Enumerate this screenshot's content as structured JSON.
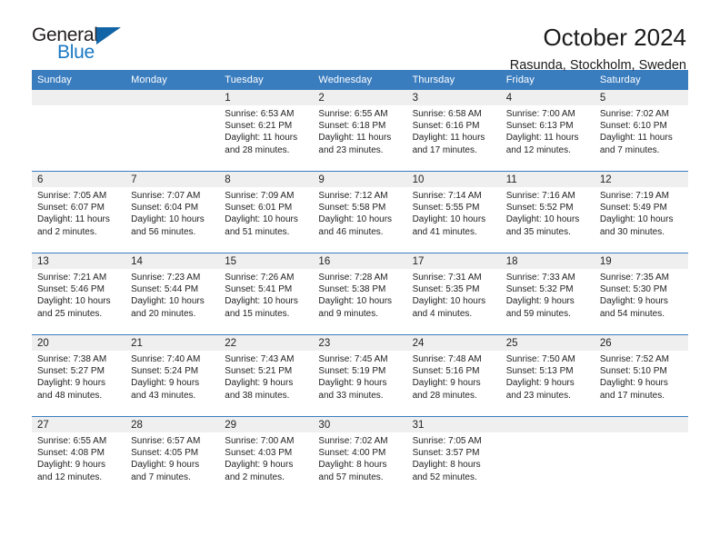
{
  "brand": {
    "name_part1": "General",
    "name_part2": "Blue",
    "triangle_color": "#1164a5",
    "blue_color": "#1878c4"
  },
  "header": {
    "title": "October 2024",
    "subtitle": "Rasunda, Stockholm, Sweden"
  },
  "theme": {
    "header_bg": "#3a7dbf",
    "daynum_bg": "#efefef",
    "row_divider": "#3a7dbf",
    "text": "#222222"
  },
  "calendar": {
    "weekday_headers": [
      "Sunday",
      "Monday",
      "Tuesday",
      "Wednesday",
      "Thursday",
      "Friday",
      "Saturday"
    ],
    "weeks": [
      [
        {
          "day": "",
          "sunrise": "",
          "sunset": "",
          "daylight_line1": "",
          "daylight_line2": ""
        },
        {
          "day": "",
          "sunrise": "",
          "sunset": "",
          "daylight_line1": "",
          "daylight_line2": ""
        },
        {
          "day": "1",
          "sunrise": "Sunrise: 6:53 AM",
          "sunset": "Sunset: 6:21 PM",
          "daylight_line1": "Daylight: 11 hours",
          "daylight_line2": "and 28 minutes."
        },
        {
          "day": "2",
          "sunrise": "Sunrise: 6:55 AM",
          "sunset": "Sunset: 6:18 PM",
          "daylight_line1": "Daylight: 11 hours",
          "daylight_line2": "and 23 minutes."
        },
        {
          "day": "3",
          "sunrise": "Sunrise: 6:58 AM",
          "sunset": "Sunset: 6:16 PM",
          "daylight_line1": "Daylight: 11 hours",
          "daylight_line2": "and 17 minutes."
        },
        {
          "day": "4",
          "sunrise": "Sunrise: 7:00 AM",
          "sunset": "Sunset: 6:13 PM",
          "daylight_line1": "Daylight: 11 hours",
          "daylight_line2": "and 12 minutes."
        },
        {
          "day": "5",
          "sunrise": "Sunrise: 7:02 AM",
          "sunset": "Sunset: 6:10 PM",
          "daylight_line1": "Daylight: 11 hours",
          "daylight_line2": "and 7 minutes."
        }
      ],
      [
        {
          "day": "6",
          "sunrise": "Sunrise: 7:05 AM",
          "sunset": "Sunset: 6:07 PM",
          "daylight_line1": "Daylight: 11 hours",
          "daylight_line2": "and 2 minutes."
        },
        {
          "day": "7",
          "sunrise": "Sunrise: 7:07 AM",
          "sunset": "Sunset: 6:04 PM",
          "daylight_line1": "Daylight: 10 hours",
          "daylight_line2": "and 56 minutes."
        },
        {
          "day": "8",
          "sunrise": "Sunrise: 7:09 AM",
          "sunset": "Sunset: 6:01 PM",
          "daylight_line1": "Daylight: 10 hours",
          "daylight_line2": "and 51 minutes."
        },
        {
          "day": "9",
          "sunrise": "Sunrise: 7:12 AM",
          "sunset": "Sunset: 5:58 PM",
          "daylight_line1": "Daylight: 10 hours",
          "daylight_line2": "and 46 minutes."
        },
        {
          "day": "10",
          "sunrise": "Sunrise: 7:14 AM",
          "sunset": "Sunset: 5:55 PM",
          "daylight_line1": "Daylight: 10 hours",
          "daylight_line2": "and 41 minutes."
        },
        {
          "day": "11",
          "sunrise": "Sunrise: 7:16 AM",
          "sunset": "Sunset: 5:52 PM",
          "daylight_line1": "Daylight: 10 hours",
          "daylight_line2": "and 35 minutes."
        },
        {
          "day": "12",
          "sunrise": "Sunrise: 7:19 AM",
          "sunset": "Sunset: 5:49 PM",
          "daylight_line1": "Daylight: 10 hours",
          "daylight_line2": "and 30 minutes."
        }
      ],
      [
        {
          "day": "13",
          "sunrise": "Sunrise: 7:21 AM",
          "sunset": "Sunset: 5:46 PM",
          "daylight_line1": "Daylight: 10 hours",
          "daylight_line2": "and 25 minutes."
        },
        {
          "day": "14",
          "sunrise": "Sunrise: 7:23 AM",
          "sunset": "Sunset: 5:44 PM",
          "daylight_line1": "Daylight: 10 hours",
          "daylight_line2": "and 20 minutes."
        },
        {
          "day": "15",
          "sunrise": "Sunrise: 7:26 AM",
          "sunset": "Sunset: 5:41 PM",
          "daylight_line1": "Daylight: 10 hours",
          "daylight_line2": "and 15 minutes."
        },
        {
          "day": "16",
          "sunrise": "Sunrise: 7:28 AM",
          "sunset": "Sunset: 5:38 PM",
          "daylight_line1": "Daylight: 10 hours",
          "daylight_line2": "and 9 minutes."
        },
        {
          "day": "17",
          "sunrise": "Sunrise: 7:31 AM",
          "sunset": "Sunset: 5:35 PM",
          "daylight_line1": "Daylight: 10 hours",
          "daylight_line2": "and 4 minutes."
        },
        {
          "day": "18",
          "sunrise": "Sunrise: 7:33 AM",
          "sunset": "Sunset: 5:32 PM",
          "daylight_line1": "Daylight: 9 hours",
          "daylight_line2": "and 59 minutes."
        },
        {
          "day": "19",
          "sunrise": "Sunrise: 7:35 AM",
          "sunset": "Sunset: 5:30 PM",
          "daylight_line1": "Daylight: 9 hours",
          "daylight_line2": "and 54 minutes."
        }
      ],
      [
        {
          "day": "20",
          "sunrise": "Sunrise: 7:38 AM",
          "sunset": "Sunset: 5:27 PM",
          "daylight_line1": "Daylight: 9 hours",
          "daylight_line2": "and 48 minutes."
        },
        {
          "day": "21",
          "sunrise": "Sunrise: 7:40 AM",
          "sunset": "Sunset: 5:24 PM",
          "daylight_line1": "Daylight: 9 hours",
          "daylight_line2": "and 43 minutes."
        },
        {
          "day": "22",
          "sunrise": "Sunrise: 7:43 AM",
          "sunset": "Sunset: 5:21 PM",
          "daylight_line1": "Daylight: 9 hours",
          "daylight_line2": "and 38 minutes."
        },
        {
          "day": "23",
          "sunrise": "Sunrise: 7:45 AM",
          "sunset": "Sunset: 5:19 PM",
          "daylight_line1": "Daylight: 9 hours",
          "daylight_line2": "and 33 minutes."
        },
        {
          "day": "24",
          "sunrise": "Sunrise: 7:48 AM",
          "sunset": "Sunset: 5:16 PM",
          "daylight_line1": "Daylight: 9 hours",
          "daylight_line2": "and 28 minutes."
        },
        {
          "day": "25",
          "sunrise": "Sunrise: 7:50 AM",
          "sunset": "Sunset: 5:13 PM",
          "daylight_line1": "Daylight: 9 hours",
          "daylight_line2": "and 23 minutes."
        },
        {
          "day": "26",
          "sunrise": "Sunrise: 7:52 AM",
          "sunset": "Sunset: 5:10 PM",
          "daylight_line1": "Daylight: 9 hours",
          "daylight_line2": "and 17 minutes."
        }
      ],
      [
        {
          "day": "27",
          "sunrise": "Sunrise: 6:55 AM",
          "sunset": "Sunset: 4:08 PM",
          "daylight_line1": "Daylight: 9 hours",
          "daylight_line2": "and 12 minutes."
        },
        {
          "day": "28",
          "sunrise": "Sunrise: 6:57 AM",
          "sunset": "Sunset: 4:05 PM",
          "daylight_line1": "Daylight: 9 hours",
          "daylight_line2": "and 7 minutes."
        },
        {
          "day": "29",
          "sunrise": "Sunrise: 7:00 AM",
          "sunset": "Sunset: 4:03 PM",
          "daylight_line1": "Daylight: 9 hours",
          "daylight_line2": "and 2 minutes."
        },
        {
          "day": "30",
          "sunrise": "Sunrise: 7:02 AM",
          "sunset": "Sunset: 4:00 PM",
          "daylight_line1": "Daylight: 8 hours",
          "daylight_line2": "and 57 minutes."
        },
        {
          "day": "31",
          "sunrise": "Sunrise: 7:05 AM",
          "sunset": "Sunset: 3:57 PM",
          "daylight_line1": "Daylight: 8 hours",
          "daylight_line2": "and 52 minutes."
        },
        {
          "day": "",
          "sunrise": "",
          "sunset": "",
          "daylight_line1": "",
          "daylight_line2": ""
        },
        {
          "day": "",
          "sunrise": "",
          "sunset": "",
          "daylight_line1": "",
          "daylight_line2": ""
        }
      ]
    ]
  }
}
